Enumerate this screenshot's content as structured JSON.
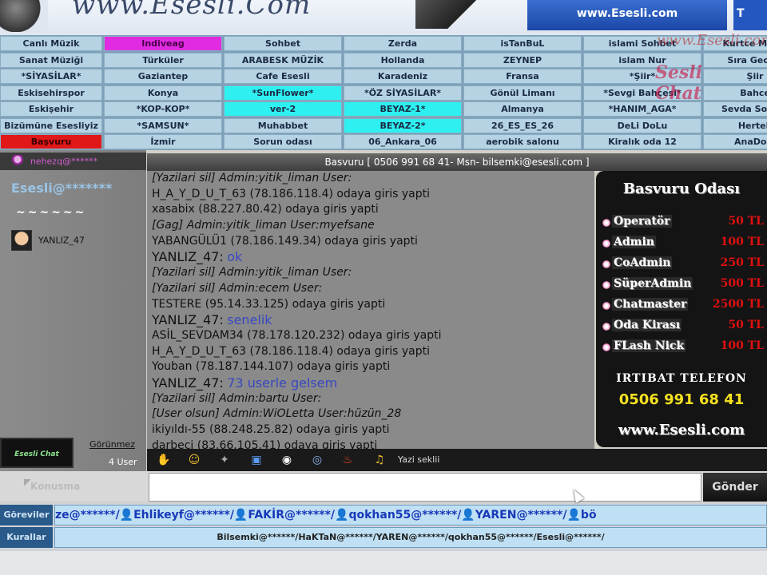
{
  "header": {
    "logo_text": "www.Esesli.Com",
    "site_url": "www.Esesli.com",
    "site_url_tail": "T"
  },
  "watermark": {
    "line1": "www.Esesli.com",
    "line2": "Sesli Chat"
  },
  "rooms": [
    [
      "Canlı Müzik",
      "Sanat Müziği",
      "*SİYASİLAR*",
      "Eskisehirspor",
      "Eskişehir",
      "Bizümüne Esesliyiz",
      "Başvuru"
    ],
    [
      "Indiveag",
      "Türküler",
      "Gaziantep",
      "Konya",
      "*KOP-KOP*",
      "*SAMSUN*",
      "İzmir"
    ],
    [
      "Sohbet",
      "ARABESK MÜZİK",
      "Cafe Esesli",
      "*SunFlower*",
      "ver-2",
      "Muhabbet",
      "Sorun odası"
    ],
    [
      "Zerda",
      "Hollanda",
      "Karadeniz",
      "*ÖZ SİYASİLAR*",
      "BEYAZ-1*",
      "BEYAZ-2*",
      "06_Ankara_06"
    ],
    [
      "isTanBuL",
      "ZEYNEP",
      "Fransa",
      "Gönül Limanı",
      "Almanya",
      "26_ES_ES_26",
      "aerobik salonu"
    ],
    [
      "islami Sohbet",
      "islam Nur",
      "*Şiir*",
      "*Sevgi Bahçesi*",
      "*HANIM_AGA*",
      "DeLi DoLu",
      "Kiralık oda 12"
    ],
    [
      "Kurtce Müzik",
      "Sıra Gecesi",
      "Şiir",
      "Bahce",
      "Sevda Sozleri",
      "Herteli",
      "AnaDolu"
    ]
  ],
  "userpanel": {
    "users": [
      "nehezq@******",
      "Esesli@*******",
      "~~~~~~",
      "YANLIZ_47"
    ],
    "invisible_label": "Görünmez",
    "user_count": "4 User",
    "logo_text": "Esesli Chat"
  },
  "titlebar": "Basvuru [ 0506 991 68 41- Msn- bilsemki@esesli.com ]",
  "chat": [
    {
      "type": "admin",
      "text": "[Yazilari sil] Admin:yitik_liman User:"
    },
    {
      "type": "sys",
      "text": "H_A_Y_D_U_T_63 (78.186.118.4) odaya giris yapti"
    },
    {
      "type": "sys",
      "text": "xasabix (88.227.80.42) odaya giris yapti"
    },
    {
      "type": "admin",
      "text": "[Gag] Admin:yitik_liman User:myefsane"
    },
    {
      "type": "sys",
      "text": "YABANGÜLÜ1 (78.186.149.34) odaya giris yapti"
    },
    {
      "type": "user",
      "nick": "YANLIZ_47:",
      "text": "ok"
    },
    {
      "type": "admin",
      "text": "[Yazilari sil] Admin:yitik_liman User:"
    },
    {
      "type": "admin",
      "text": "[Yazilari sil] Admin:ecem User:"
    },
    {
      "type": "sys",
      "text": "TESTERE (95.14.33.125) odaya giris yapti"
    },
    {
      "type": "user",
      "nick": "YANLIZ_47:",
      "text": "senelik"
    },
    {
      "type": "sys",
      "text": "ASİL_SEVDAM34 (78.178.120.232) odaya giris yapti"
    },
    {
      "type": "sys",
      "text": "H_A_Y_D_U_T_63 (78.186.118.4) odaya giris yapti"
    },
    {
      "type": "sys",
      "text": "Youban (78.187.144.107) odaya giris yapti"
    },
    {
      "type": "user",
      "nick": "YANLIZ_47:",
      "text": "73 userle gelsem"
    },
    {
      "type": "admin",
      "text": "[Yazilari sil] Admin:bartu User:"
    },
    {
      "type": "admin",
      "text": "[User olsun] Admin:WiOLetta User:hüzün_28"
    },
    {
      "type": "sys",
      "text": "ikiyıldı-55 (88.248.25.82) odaya giris yapti"
    },
    {
      "type": "sys",
      "text": "darbeci (83.66.105.41) odaya giris yapti"
    }
  ],
  "promo": {
    "title": "Basvuru Odası",
    "items": [
      {
        "label": "Operatör",
        "price": "50 TL"
      },
      {
        "label": "Admin",
        "price": "100 TL"
      },
      {
        "label": "CoAdmin",
        "price": "250 TL"
      },
      {
        "label": "SüperAdmin",
        "price": "500 TL"
      },
      {
        "label": "Chatmaster",
        "price": "2500 TL"
      },
      {
        "label": "Oda Kirası",
        "price": "50 TL"
      },
      {
        "label": "FLash Nick",
        "price": "100 TL"
      }
    ],
    "contact_label": "IRTIBAT TELEFON",
    "phone": "0506 991 68 41",
    "url": "www.Esesli.com"
  },
  "toolbar": {
    "icons": [
      "hand-icon",
      "smiley-icon",
      "dog-icon",
      "window-icon",
      "record-icon",
      "eye-icon",
      "torch-icon",
      "bell-icon"
    ],
    "label": "Yazi seklii"
  },
  "input": {
    "talk_label": "Konusma",
    "value": "",
    "send_label": "Gönder"
  },
  "bottom": {
    "label1": "Göreviler",
    "label2": "Kurallar",
    "strip1": "ze@******/👤Ehlikeyf@******/👤FAKİR@******/👤qokhan55@******/👤YAREN@******/👤bö",
    "strip2": "Bilsemki@******/HaKTaN@******/YAREN@******/qokhan55@******/Esesli@******/"
  },
  "colors": {
    "room_bg": "#b5d3e3",
    "room_magenta": "#e02be0",
    "room_cyan": "#2ef0f0",
    "room_red": "#e01818",
    "chat_bg": "#8a8a8a",
    "link_blue": "#3848c0",
    "promo_price": "#e01010",
    "phone_yellow": "#f5e020"
  }
}
